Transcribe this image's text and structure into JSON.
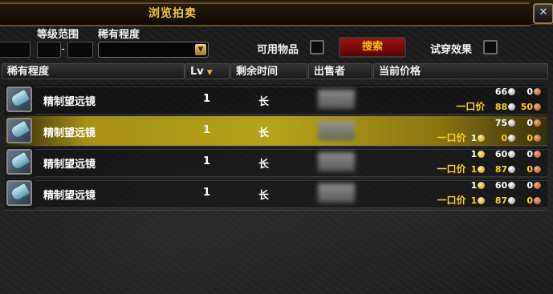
{
  "window": {
    "title": "浏览拍卖",
    "close_glyph": "✕"
  },
  "filters": {
    "level_range_label": "等级范围",
    "level_dash": "-",
    "rarity_label": "稀有程度",
    "usable_label": "可用物品",
    "search_label": "搜索",
    "preview_label": "试穿效果"
  },
  "columns": {
    "rarity": "稀有程度",
    "level": "Lv",
    "time_left": "剩余时间",
    "seller": "出售者",
    "current_price": "当前价格"
  },
  "icons": {
    "sort": "sort-down-arrow-icon",
    "dropdown": "chevron-down-icon",
    "item": "telescope-icon",
    "gold": "gold-coin-icon",
    "silver": "silver-coin-icon",
    "copper": "copper-coin-icon"
  },
  "colors": {
    "title_gold": "#f1c640",
    "buyout_yellow": "#ffd11a",
    "search_red": "#a01010",
    "selected_row": "#bfa519"
  },
  "buyout_label": "一口价",
  "rows": [
    {
      "name": "精制望远镜",
      "level": "1",
      "time": "长",
      "bid": {
        "gold": "",
        "silver": "66",
        "copper": "0"
      },
      "buyout": {
        "gold": "",
        "silver": "88",
        "copper": "50"
      },
      "selected": false
    },
    {
      "name": "精制望远镜",
      "level": "1",
      "time": "长",
      "bid": {
        "gold": "",
        "silver": "75",
        "copper": "0"
      },
      "buyout": {
        "gold": "1",
        "silver": "0",
        "copper": "0"
      },
      "selected": true
    },
    {
      "name": "精制望远镜",
      "level": "1",
      "time": "长",
      "bid": {
        "gold": "1",
        "silver": "60",
        "copper": "0"
      },
      "buyout": {
        "gold": "1",
        "silver": "87",
        "copper": "0"
      },
      "selected": false
    },
    {
      "name": "精制望远镜",
      "level": "1",
      "time": "长",
      "bid": {
        "gold": "1",
        "silver": "60",
        "copper": "0"
      },
      "buyout": {
        "gold": "1",
        "silver": "87",
        "copper": "0"
      },
      "selected": false
    }
  ]
}
